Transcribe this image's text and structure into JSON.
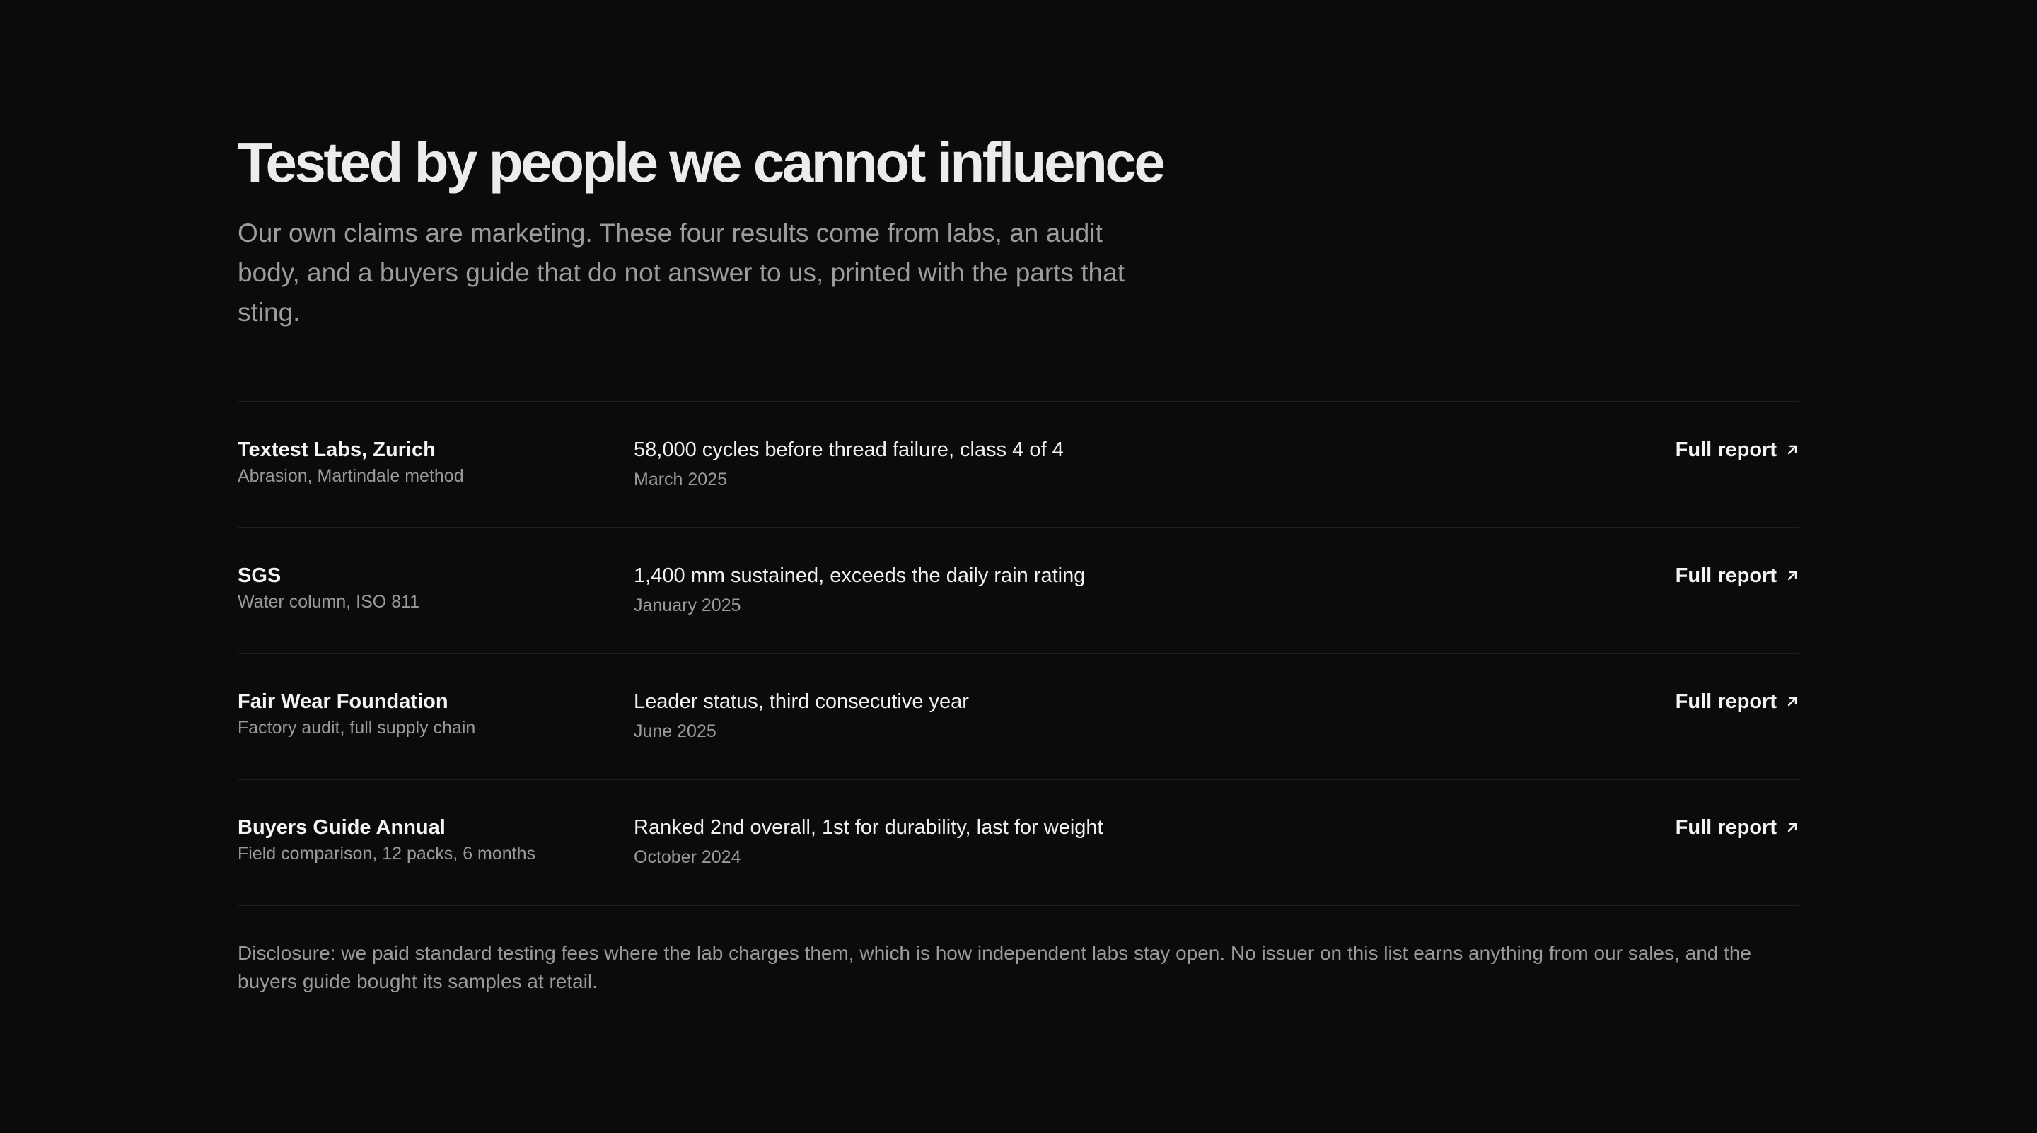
{
  "header": {
    "title": "Tested by people we cannot influence",
    "intro": "Our own claims are marketing. These four results come from labs, an audit body, and a buyers guide that do not answer to us, printed with the parts that sting."
  },
  "results": [
    {
      "issuer": "Textest Labs, Zurich",
      "method": "Abrasion, Martindale method",
      "result": "58,000 cycles before thread failure, class 4 of 4",
      "date": "March 2025",
      "link_label": "Full report",
      "link_icon": "arrow-up-right-icon"
    },
    {
      "issuer": "SGS",
      "method": "Water column, ISO 811",
      "result": "1,400 mm sustained, exceeds the daily rain rating",
      "date": "January 2025",
      "link_label": "Full report",
      "link_icon": "arrow-up-right-icon"
    },
    {
      "issuer": "Fair Wear Foundation",
      "method": "Factory audit, full supply chain",
      "result": "Leader status, third consecutive year",
      "date": "June 2025",
      "link_label": "Full report",
      "link_icon": "arrow-up-right-icon"
    },
    {
      "issuer": "Buyers Guide Annual",
      "method": "Field comparison, 12 packs, 6 months",
      "result": "Ranked 2nd overall, 1st for durability, last for weight",
      "date": "October 2024",
      "link_label": "Full report",
      "link_icon": "arrow-up-right-icon"
    }
  ],
  "disclosure": "Disclosure: we paid standard testing fees where the lab charges them, which is how independent labs stay open. No issuer on this list earns anything from our sales, and the buyers guide bought its samples at retail.",
  "colors": {
    "background": "#0b0b0b",
    "primary_text": "#f2f2f2",
    "secondary_text": "#9a9a9a",
    "divider": "#1f1f1f"
  }
}
